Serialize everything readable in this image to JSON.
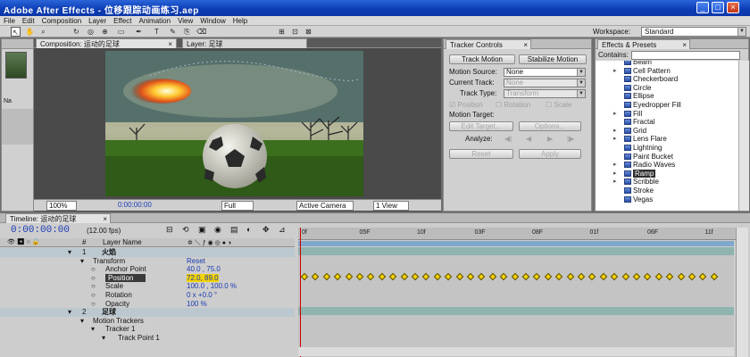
{
  "window": {
    "title": "Adobe After Effects - 位移跟踪动画练习.aep"
  },
  "menu": [
    "File",
    "Edit",
    "Composition",
    "Layer",
    "Effect",
    "Animation",
    "View",
    "Window",
    "Help"
  ],
  "toolbar": {
    "workspace_label": "Workspace:",
    "workspace_value": "Standard"
  },
  "project": {
    "col_name": "Na"
  },
  "comp": {
    "tab_comp": "Composition: 运动的足球",
    "tab_layer": "Layer: 足球",
    "zoom": "100%",
    "timecode": "0:00:00:00",
    "resolution": "Full",
    "camera": "Active Camera",
    "views": "1 View"
  },
  "tracker": {
    "tab": "Tracker Controls",
    "track_motion": "Track Motion",
    "stabilize_motion": "Stabilize Motion",
    "motion_source_label": "Motion Source:",
    "motion_source_value": "None",
    "current_track_label": "Current Track:",
    "current_track_value": "None",
    "track_type_label": "Track Type:",
    "track_type_value": "Transform",
    "position": "Position",
    "rotation": "Rotation",
    "scale": "Scale",
    "motion_target_label": "Motion Target:",
    "edit_target": "Edit Target...",
    "options": "Options...",
    "analyze_label": "Analyze:",
    "reset": "Reset",
    "apply": "Apply"
  },
  "effects": {
    "tab": "Effects & Presets",
    "contains_label": "Contains:",
    "items": [
      {
        "label": "Beam",
        "arrow": ""
      },
      {
        "label": "Cell Pattern",
        "arrow": "▸"
      },
      {
        "label": "Checkerboard",
        "arrow": ""
      },
      {
        "label": "Circle",
        "arrow": ""
      },
      {
        "label": "Ellipse",
        "arrow": ""
      },
      {
        "label": "Eyedropper Fill",
        "arrow": ""
      },
      {
        "label": "Fill",
        "arrow": "▸"
      },
      {
        "label": "Fractal",
        "arrow": ""
      },
      {
        "label": "Grid",
        "arrow": "▸"
      },
      {
        "label": "Lens Flare",
        "arrow": "▸"
      },
      {
        "label": "Lightning",
        "arrow": ""
      },
      {
        "label": "Paint Bucket",
        "arrow": ""
      },
      {
        "label": "Radio Waves",
        "arrow": "▸"
      },
      {
        "label": "Ramp",
        "arrow": "▸",
        "highlight": true
      },
      {
        "label": "Scribble",
        "arrow": "▸"
      },
      {
        "label": "Stroke",
        "arrow": ""
      },
      {
        "label": "Vegas",
        "arrow": ""
      }
    ]
  },
  "timeline": {
    "tab": "Timeline: 运动的足球",
    "timecode": "0:00:00:00",
    "fps": "(12.00 fps)",
    "col_num": "#",
    "col_layer_name": "Layer Name",
    "ruler": [
      "0f",
      "05F",
      "10f",
      "03F",
      "08F",
      "01f",
      "06F",
      "11f"
    ],
    "rows": [
      {
        "kind": "layer",
        "num": "1",
        "name": "火焰",
        "indent": 0
      },
      {
        "kind": "group",
        "name": "Transform",
        "value": "Reset",
        "indent": 1
      },
      {
        "kind": "prop",
        "name": "Anchor Point",
        "value": "40.0 , 75.0",
        "indent": 2
      },
      {
        "kind": "prop",
        "name": "Position",
        "value": "72.0, 89.0",
        "indent": 2,
        "selected": true
      },
      {
        "kind": "prop",
        "name": "Scale",
        "value": "100.0 , 100.0 %",
        "indent": 2
      },
      {
        "kind": "prop",
        "name": "Rotation",
        "value": "0 x +0.0 °",
        "indent": 2
      },
      {
        "kind": "prop",
        "name": "Opacity",
        "value": "100 %",
        "indent": 2
      },
      {
        "kind": "layer",
        "num": "2",
        "name": "足球",
        "indent": 0
      },
      {
        "kind": "group",
        "name": "Motion Trackers",
        "value": "",
        "indent": 1
      },
      {
        "kind": "group",
        "name": "Tracker 1",
        "value": "",
        "indent": 2
      },
      {
        "kind": "group",
        "name": "Track Point 1",
        "value": "",
        "indent": 3
      }
    ],
    "keyframe_count": 38
  },
  "colors": {
    "title_bar": "#0c3bb4",
    "accent_blue": "#1d3bb8",
    "keyframe": "#f4d300",
    "playhead": "#cc0000"
  }
}
